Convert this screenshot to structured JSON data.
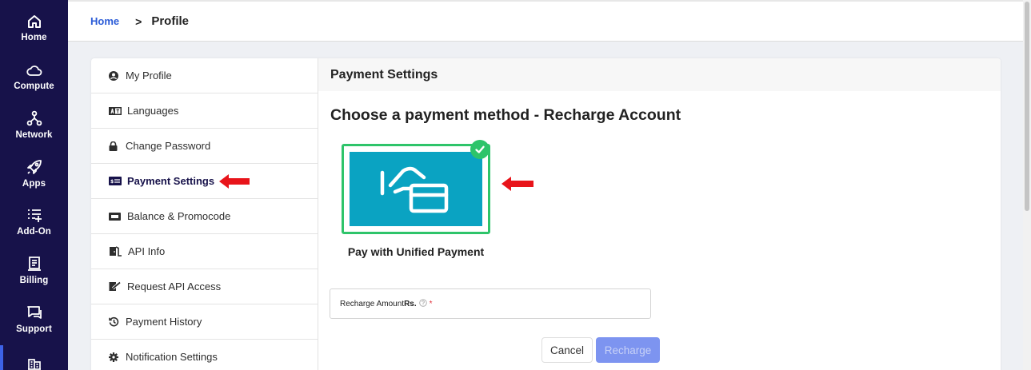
{
  "nav": {
    "items": [
      {
        "label": "Home",
        "icon": "home-icon"
      },
      {
        "label": "Compute",
        "icon": "cloud-icon"
      },
      {
        "label": "Network",
        "icon": "network-icon"
      },
      {
        "label": "Apps",
        "icon": "rocket-icon"
      },
      {
        "label": "Add-On",
        "icon": "list-add-icon"
      },
      {
        "label": "Billing",
        "icon": "receipt-icon"
      },
      {
        "label": "Support",
        "icon": "chat-icon"
      },
      {
        "label": "",
        "icon": "building-icon"
      }
    ]
  },
  "breadcrumb": {
    "home": "Home",
    "separator": ">",
    "current": "Profile"
  },
  "menu": {
    "items": [
      {
        "label": "My Profile",
        "icon": "user-circle-icon"
      },
      {
        "label": "Languages",
        "icon": "language-icon"
      },
      {
        "label": "Change Password",
        "icon": "lock-icon"
      },
      {
        "label": "Payment Settings",
        "icon": "payment-card-icon",
        "active": true
      },
      {
        "label": "Balance & Promocode",
        "icon": "ticket-icon"
      },
      {
        "label": "API Info",
        "icon": "door-icon"
      },
      {
        "label": "Request API Access",
        "icon": "edit-icon"
      },
      {
        "label": "Payment History",
        "icon": "history-icon"
      },
      {
        "label": "Notification Settings",
        "icon": "gear-icon"
      }
    ]
  },
  "content": {
    "header": "Payment Settings",
    "title": "Choose a payment method - Recharge Account",
    "payment_option": {
      "label": "Pay with Unified Payment",
      "selected": true,
      "icon": "card-payment-icon"
    },
    "amount_field": {
      "label": "Recharge Amount",
      "currency": "Rs.",
      "required_mark": "*",
      "help_icon": "question-circle-icon"
    },
    "cancel_label": "Cancel",
    "recharge_label": "Recharge"
  },
  "colors": {
    "sidebar": "#17124a",
    "accent": "#2a5bd7",
    "selected_border": "#2ec46a",
    "payment_tile": "#0aa3c2",
    "annotation_arrow": "#e8141a",
    "recharge_disabled": "#7d94f0"
  }
}
